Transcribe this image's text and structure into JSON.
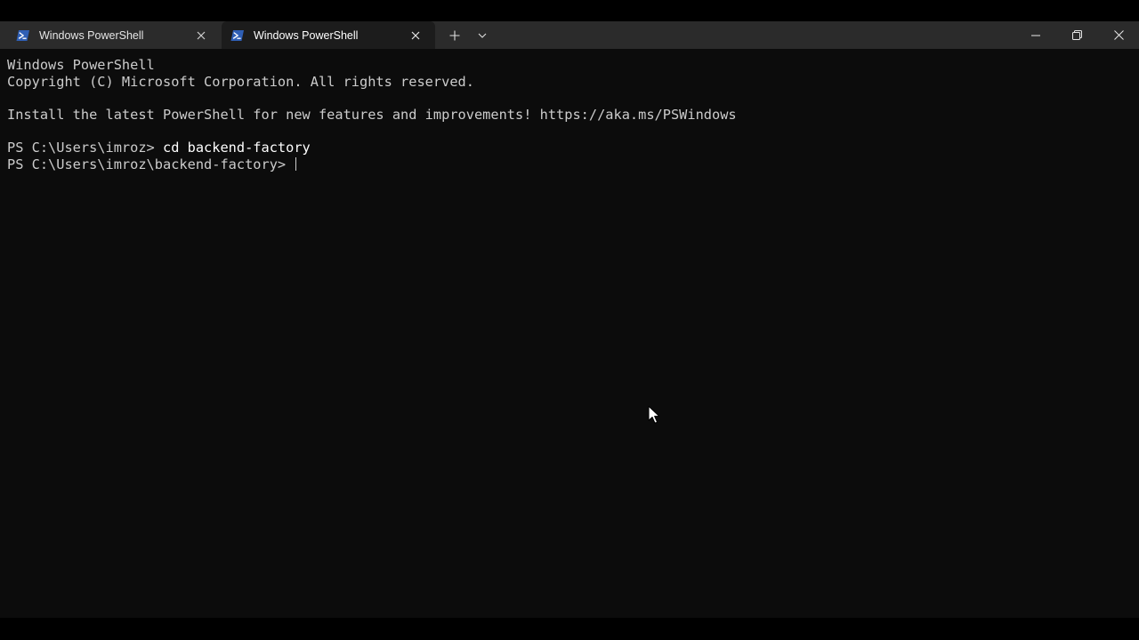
{
  "window": {
    "tabs": [
      {
        "label": "Windows PowerShell",
        "active": false
      },
      {
        "label": "Windows PowerShell",
        "active": true
      }
    ],
    "new_tab_icon": "plus-icon",
    "dropdown_icon": "chevron-down-icon",
    "caption_buttons": [
      "minimize-icon",
      "restore-icon",
      "close-icon"
    ]
  },
  "terminal": {
    "lines": [
      {
        "prompt": "",
        "text": "Windows PowerShell"
      },
      {
        "prompt": "",
        "text": "Copyright (C) Microsoft Corporation. All rights reserved."
      },
      {
        "prompt": "",
        "text": ""
      },
      {
        "prompt": "",
        "text": "Install the latest PowerShell for new features and improvements! https://aka.ms/PSWindows"
      },
      {
        "prompt": "",
        "text": ""
      },
      {
        "prompt": "PS C:\\Users\\imroz> ",
        "text": "cd backend-factory"
      },
      {
        "prompt": "PS C:\\Users\\imroz\\backend-factory> ",
        "text": ""
      }
    ]
  },
  "colors": {
    "terminal_bg": "#0c0c0c",
    "titlebar_bg": "#2b2b2b",
    "active_tab_bg": "#1c1c1c",
    "text": "#cccccc",
    "powershell_icon": "#2f5fb5"
  }
}
